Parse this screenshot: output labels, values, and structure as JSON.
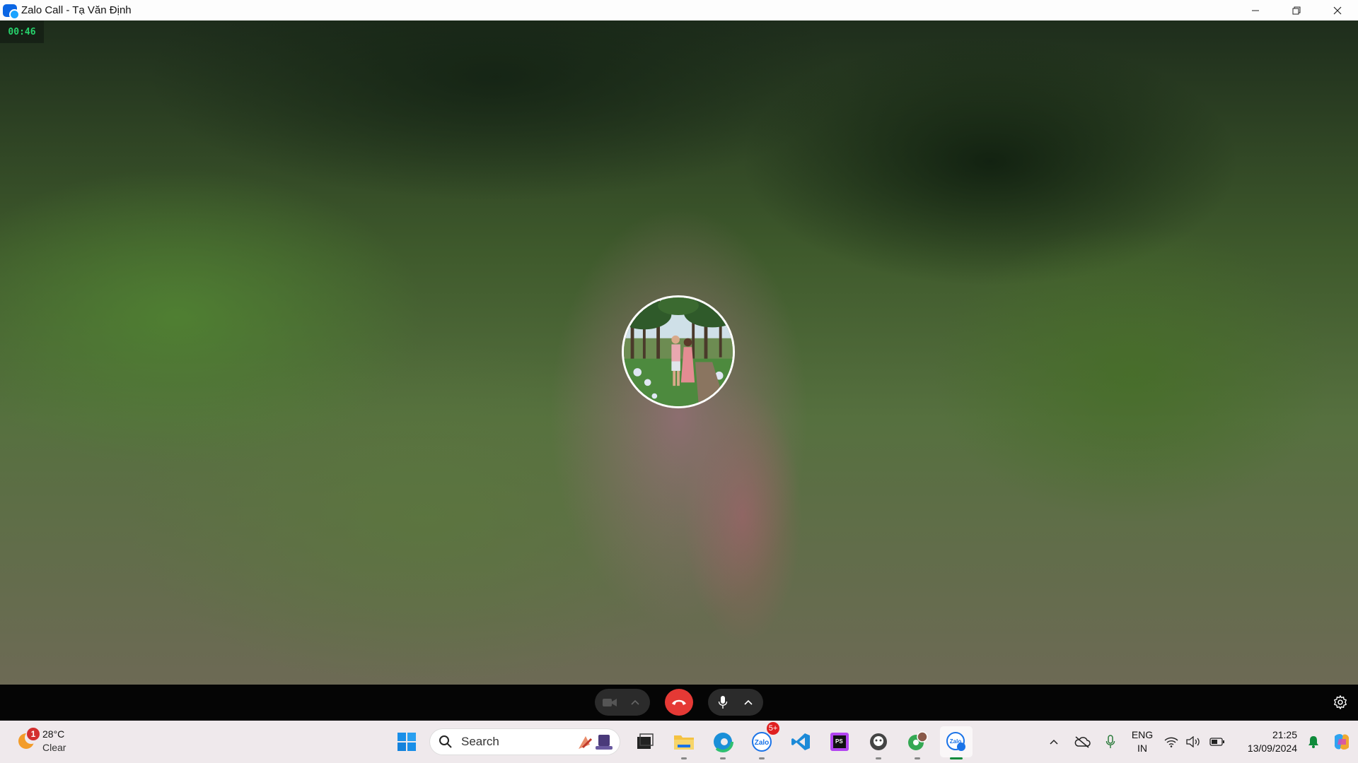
{
  "window": {
    "title": "Zalo Call - Tạ Văn Định",
    "controls": [
      "minimize",
      "restore",
      "close"
    ]
  },
  "call": {
    "duration": "00:46",
    "avatar_description": "contact-avatar",
    "controls": {
      "camera_icon": "video-camera-icon",
      "camera_options_icon": "chevron-up-icon",
      "end_call_icon": "hang-up-icon",
      "mic_icon": "microphone-icon",
      "mic_options_icon": "chevron-up-icon",
      "settings_icon": "gear-icon"
    },
    "colors": {
      "timer_text": "#27d36c",
      "end_call": "#e53935"
    }
  },
  "taskbar": {
    "weather": {
      "temperature": "28°C",
      "condition": "Clear",
      "alert_count": "1"
    },
    "search": {
      "label": "Search"
    },
    "apps": [
      {
        "name": "start",
        "icon": "windows-start-icon"
      },
      {
        "name": "task-view",
        "icon": "task-view-icon"
      },
      {
        "name": "file-explorer",
        "icon": "folder-icon"
      },
      {
        "name": "edge",
        "icon": "edge-browser-icon"
      },
      {
        "name": "zalo",
        "icon": "zalo-icon",
        "badge": "5+"
      },
      {
        "name": "vscode",
        "icon": "vscode-icon"
      },
      {
        "name": "phpstorm",
        "icon": "phpstorm-icon"
      },
      {
        "name": "github-desktop",
        "icon": "github-icon"
      },
      {
        "name": "chrome-profile",
        "icon": "chrome-icon"
      },
      {
        "name": "zalo-call",
        "icon": "zalo-call-icon",
        "active": true
      }
    ],
    "tray": {
      "language_line1": "ENG",
      "language_line2": "IN",
      "time": "21:25",
      "date": "13/09/2024"
    }
  }
}
